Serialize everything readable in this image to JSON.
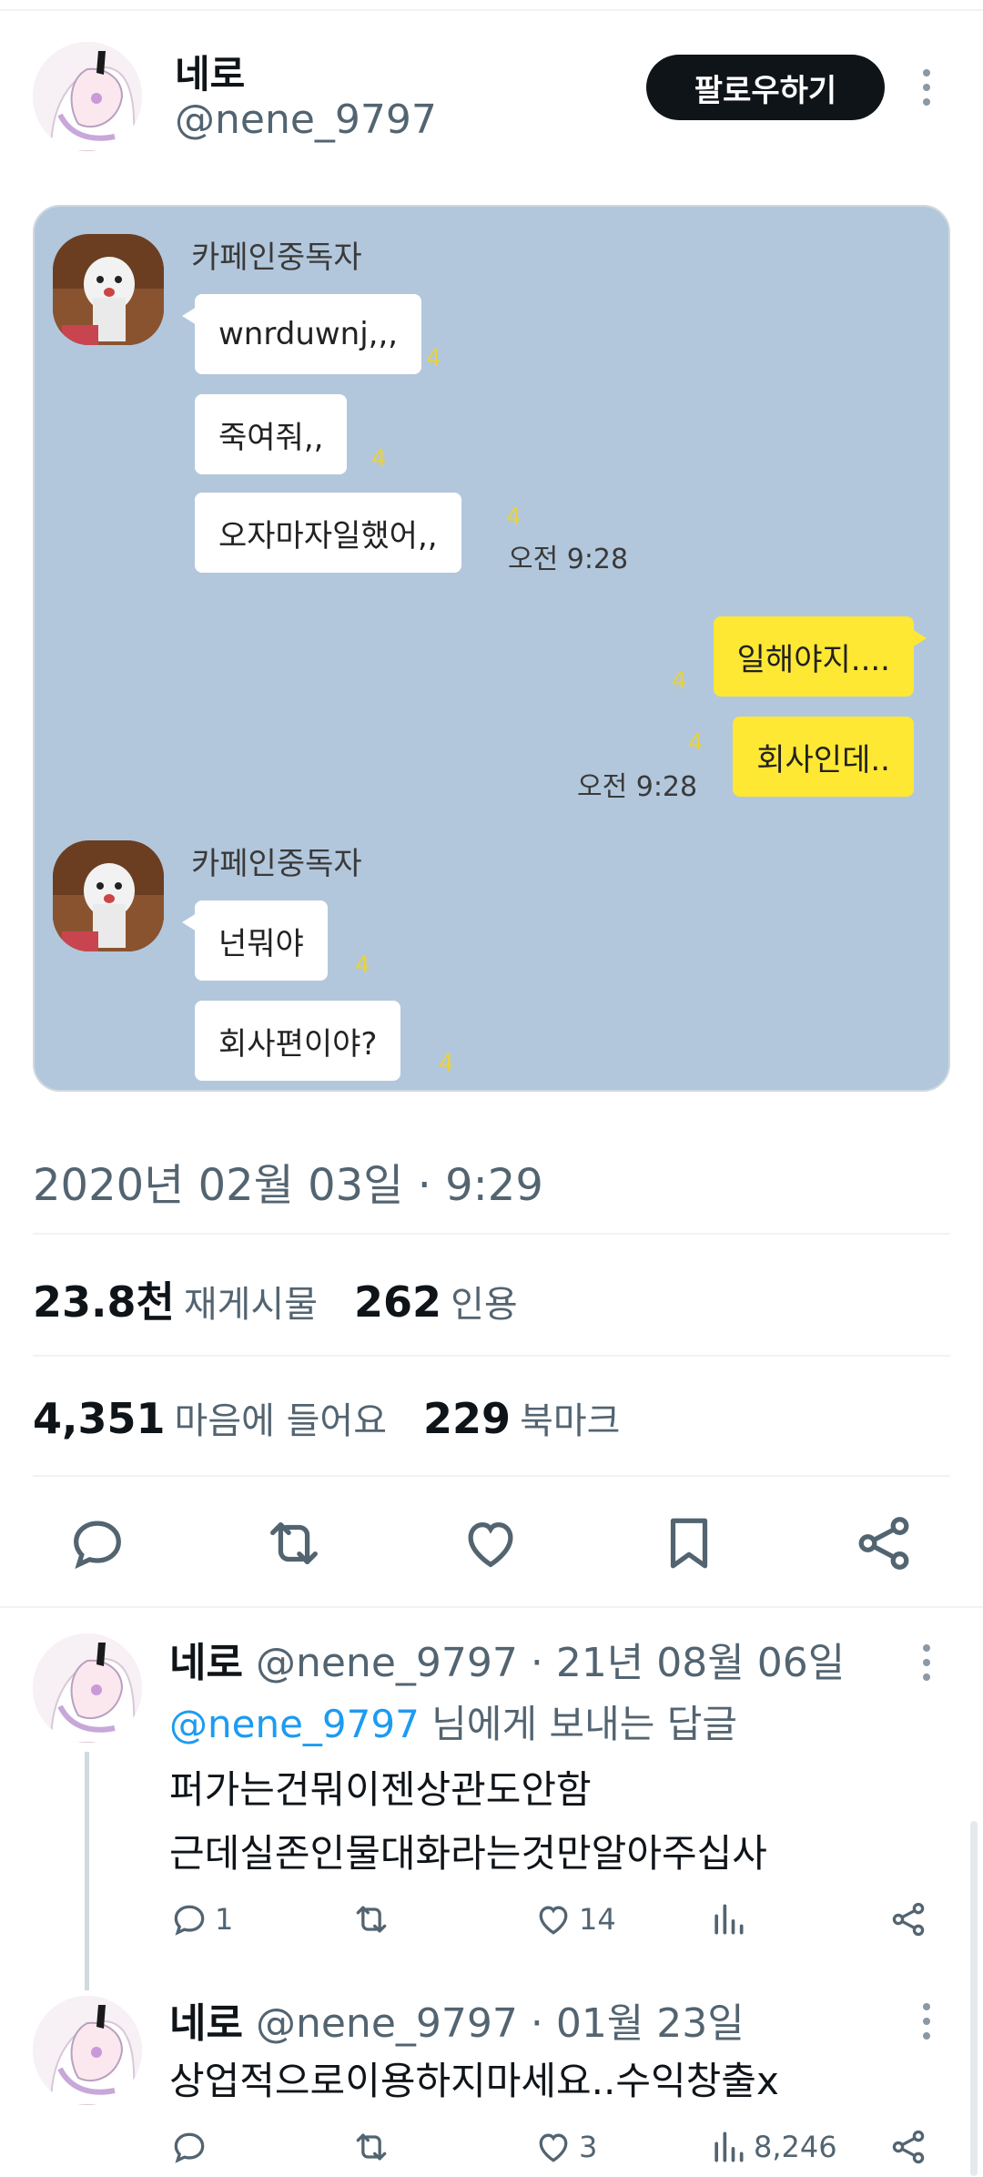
{
  "header": {
    "name": "네로",
    "handle": "@nene_9797",
    "follow_label": "팔로우하기"
  },
  "chat": {
    "groups": [
      {
        "sender": "카페인중독자",
        "messages": [
          {
            "text": "wnrduwnj,,,",
            "unread": "4"
          },
          {
            "text": "죽여줘,,",
            "unread": "4"
          },
          {
            "text": "오자마자일했어,,",
            "unread": "4",
            "time": "오전 9:28"
          }
        ]
      },
      {
        "sender": "",
        "messages": [
          {
            "text": "일해야지....",
            "unread": "4"
          },
          {
            "text": "회사인데..",
            "unread": "4",
            "time": "오전 9:28"
          }
        ]
      },
      {
        "sender": "카페인중독자",
        "messages": [
          {
            "text": "넌뭐야",
            "unread": "4"
          },
          {
            "text": "회사편이야?",
            "unread": "4"
          }
        ]
      }
    ]
  },
  "tweet": {
    "timestamp": "2020년 02월 03일 · 9:29",
    "retweets_value": "23.8천",
    "retweets_label": "재게시물",
    "quotes_value": "262",
    "quotes_label": "인용",
    "likes_value": "4,351",
    "likes_label": "마음에 들어요",
    "bookmarks_value": "229",
    "bookmarks_label": "북마크"
  },
  "actions": [
    "reply-icon",
    "retweet-icon",
    "like-icon",
    "bookmark-icon",
    "share-icon"
  ],
  "replies": [
    {
      "name": "네로",
      "handle_date": "@nene_9797 · 21년 08월 06일",
      "reply_to_handle": "@nene_9797",
      "reply_to_suffix": " 님에게 보내는 답글",
      "lines": [
        "퍼가는건뭐이젠상관도안함",
        "근데실존인물대화라는것만알아주십사"
      ],
      "reply_count": "1",
      "retweet_count": "",
      "like_count": "14",
      "view_count": ""
    },
    {
      "name": "네로",
      "handle_date": "@nene_9797 · 01월 23일",
      "lines": [
        "상업적으로이용하지마세요..수익창출x"
      ],
      "reply_count": "",
      "retweet_count": "",
      "like_count": "3",
      "view_count": "8,246"
    }
  ],
  "colors": {
    "chat_bg": "#b2c7dc",
    "my_bubble": "#fee833",
    "their_bubble": "#ffffff",
    "mention": "#1d9bf0",
    "secondary_text": "#536471"
  }
}
